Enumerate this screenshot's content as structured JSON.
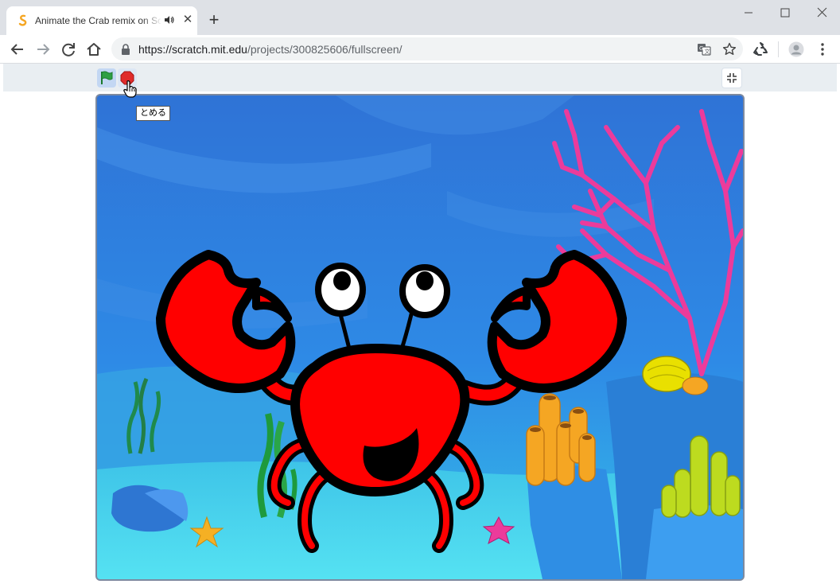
{
  "browser": {
    "tab_title": "Animate the Crab remix on Scratch",
    "url_host": "https://scratch.mit.edu",
    "url_path": "/projects/300825606/fullscreen/",
    "new_tab_label": "+",
    "close_label": "✕"
  },
  "player": {
    "stop_tooltip": "とめる"
  },
  "icons": [
    "back-icon",
    "forward-icon",
    "reload-icon",
    "home-icon",
    "lock-icon",
    "translate-icon",
    "star-icon",
    "extension-icon",
    "profile-icon",
    "menu-icon",
    "green-flag-icon",
    "stop-icon",
    "exit-fullscreen-icon",
    "audio-icon",
    "hand-cursor-icon"
  ],
  "colors": {
    "crab_red": "#ff0000",
    "coral_pink": "#ec3b9b",
    "water_blue": "#2f78dc",
    "flag_green": "#2ea043",
    "stop_red": "#e02b2b"
  }
}
